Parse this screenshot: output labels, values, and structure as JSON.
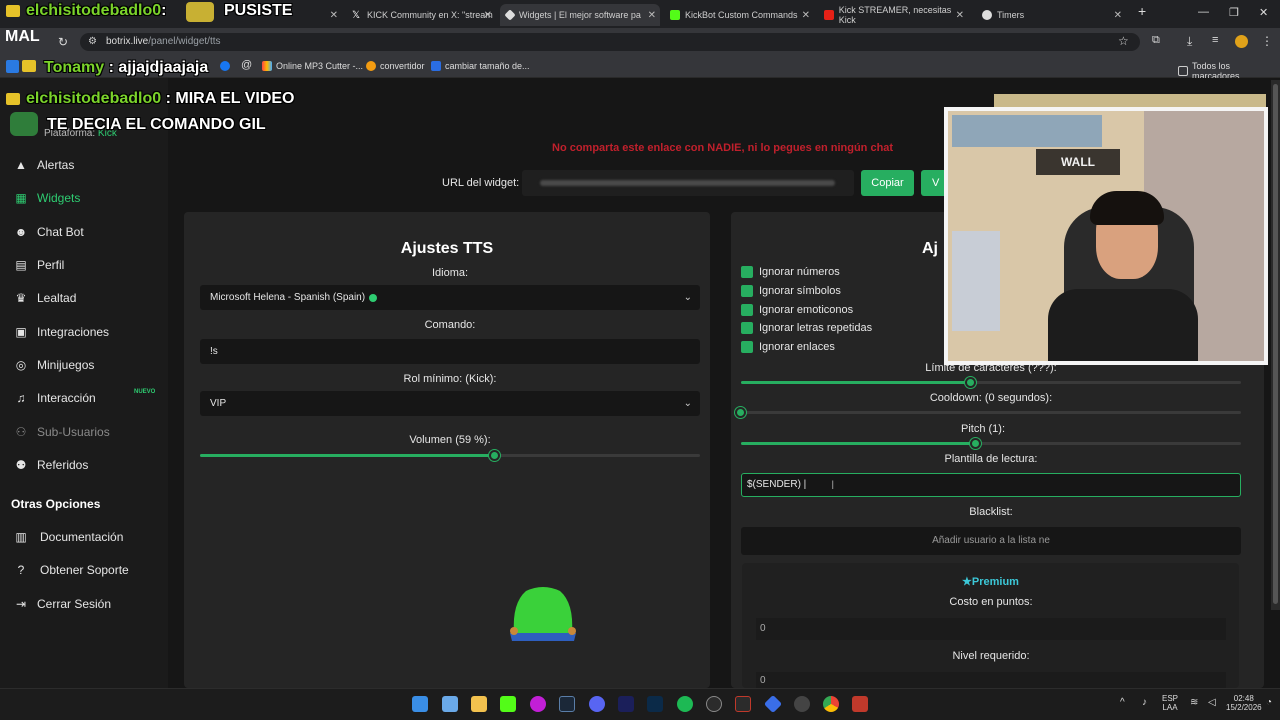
{
  "tabs": [
    {
      "label": "",
      "active": false
    },
    {
      "label": "KICK Community en X: \"stream",
      "active": false
    },
    {
      "label": "Widgets | El mejor software pa",
      "active": true
    },
    {
      "label": "KickBot Custom Commands",
      "active": false
    },
    {
      "label": "Kick STREAMER, necesitas Kick",
      "active": false
    },
    {
      "label": "Timers",
      "active": false
    }
  ],
  "address": {
    "host": "botrix.live",
    "path": "/panel/widget/tts"
  },
  "bookmarks": {
    "items": [
      "Online MP3 Cutter -...",
      "convertidor",
      "cambiar tamaño de..."
    ],
    "all_label": "Todos los marcadores"
  },
  "sidebar": {
    "platform_label": "Plataforma:",
    "platform_value": "Kick",
    "items": [
      {
        "label": "Alertas",
        "icon": "warning-icon"
      },
      {
        "label": "Widgets",
        "icon": "grid-icon"
      },
      {
        "label": "Chat Bot",
        "icon": "robot-icon"
      },
      {
        "label": "Perfil",
        "icon": "profile-card-icon"
      },
      {
        "label": "Lealtad",
        "icon": "trophy-icon"
      },
      {
        "label": "Integraciones",
        "icon": "plug-icon"
      },
      {
        "label": "Minijuegos",
        "icon": "gamepad-icon"
      },
      {
        "label": "Interacción",
        "icon": "music-icon"
      },
      {
        "label": "Sub-Usuarios",
        "icon": "users-icon"
      },
      {
        "label": "Referidos",
        "icon": "referral-icon"
      }
    ],
    "new_badge": "NUEVO",
    "section_title": "Otras Opciones",
    "other_items": [
      {
        "label": "Documentación",
        "icon": "document-icon"
      },
      {
        "label": "Obtener Soporte",
        "icon": "help-icon"
      },
      {
        "label": "Cerrar Sesión",
        "icon": "logout-icon"
      }
    ]
  },
  "header": {
    "warning": "No comparta este enlace con NADIE, ni lo pegues en ningún chat",
    "url_label": "URL del widget:",
    "copy_label": "Copiar",
    "view_label": "V"
  },
  "tts": {
    "title": "Ajustes TTS",
    "language_label": "Idioma:",
    "language_value": "Microsoft Helena - Spanish (Spain)",
    "command_label": "Comando:",
    "command_value": "!s",
    "role_label": "Rol mínimo: (Kick):",
    "role_value": "VIP",
    "volume_label": "Volumen (59 %):",
    "volume_percent": 59
  },
  "advanced": {
    "title_partial": "Aj",
    "checkboxes": [
      "Ignorar números",
      "Ignorar símbolos",
      "Ignorar emoticonos",
      "Ignorar letras repetidas",
      "Ignorar enlaces"
    ],
    "char_limit_label": "Límite de caracteres (???):",
    "char_limit_fraction": 0.46,
    "cooldown_label": "Cooldown: (0 segundos):",
    "cooldown_fraction": 0,
    "pitch_label": "Pitch (1):",
    "pitch_fraction": 0.47,
    "template_label": "Plantilla de lectura:",
    "template_value": "$(SENDER) |",
    "blacklist_label": "Blacklist:",
    "blacklist_placeholder": "Añadir usuario a la lista ne",
    "premium_label": "Premium",
    "cost_label": "Costo en puntos:",
    "cost_value": "0",
    "level_label": "Nivel requerido:",
    "level_value": "0"
  },
  "overlay": {
    "mal": "MAL",
    "lines": [
      {
        "name": "elchisitodebadlo0",
        "text": ":",
        "extra": "PUSISTE"
      },
      {
        "name": "Tonamy",
        "text": ": ajjajdjaajaja"
      },
      {
        "name": "elchisitodebadlo0",
        "text": ": MIRA EL VIDEO"
      },
      {
        "name": "",
        "text": "TE DECIA EL COMANDO GIL"
      }
    ],
    "webcam_sign": "WALL"
  },
  "tray": {
    "lang": "ESP",
    "lang2": "LAA",
    "time": "02:48",
    "date": "15/2/2026"
  },
  "colors": {
    "accent": "#27ae60",
    "warning": "#c0202c",
    "premium": "#3cc8d8"
  }
}
